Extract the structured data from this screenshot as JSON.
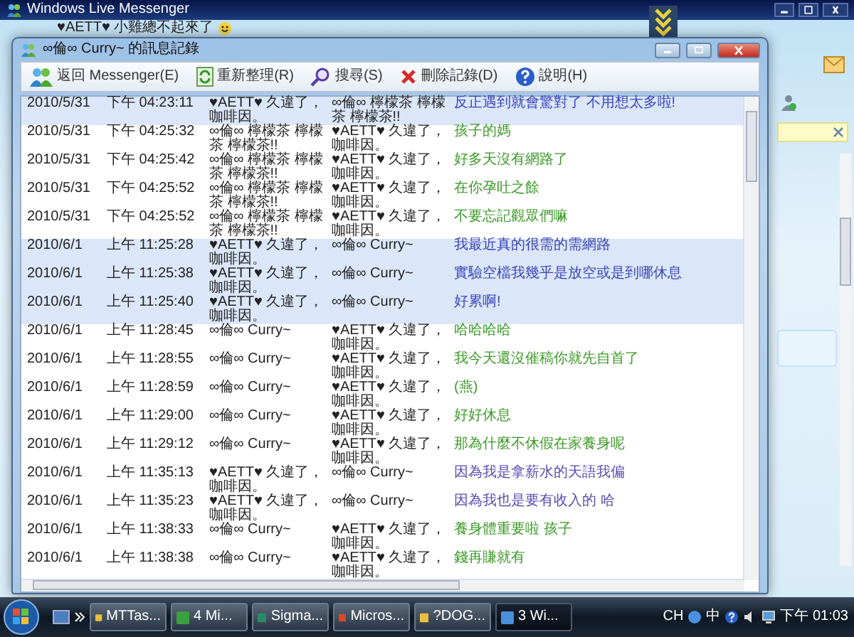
{
  "messenger": {
    "title": "Windows Live Messenger",
    "contact_status": "♥AETT♥ 小雞總不起來了"
  },
  "history_window": {
    "title": "∞倫∞ Curry~ 的訊息記錄",
    "toolbar": [
      {
        "label": "返回 Messenger(E)"
      },
      {
        "label": "重新整理(R)"
      },
      {
        "label": "搜尋(S)"
      },
      {
        "label": "刪除記錄(D)"
      },
      {
        "label": "說明(H)"
      }
    ],
    "rows": [
      {
        "date": "2010/5/31",
        "time": "下午 04:23:11",
        "from": "♥AETT♥ 久違了，咖啡因。",
        "to": "∞倫∞ 檸檬茶 檸檬茶 檸檬茶!!",
        "message": "反正遇到就會驚對了 不用想太多啦!",
        "selected": true,
        "color": "#3a44b8"
      },
      {
        "date": "2010/5/31",
        "time": "下午 04:25:32",
        "from": "∞倫∞ 檸檬茶 檸檬茶 檸檬茶!!",
        "to": "♥AETT♥ 久違了，咖啡因。",
        "message": "孩子的媽",
        "selected": false,
        "color": "#3c9a28"
      },
      {
        "date": "2010/5/31",
        "time": "下午 04:25:42",
        "from": "∞倫∞ 檸檬茶 檸檬茶 檸檬茶!!",
        "to": "♥AETT♥ 久違了，咖啡因。",
        "message": "好多天沒有網路了",
        "selected": false,
        "color": "#3c9a28"
      },
      {
        "date": "2010/5/31",
        "time": "下午 04:25:52",
        "from": "∞倫∞ 檸檬茶 檸檬茶 檸檬茶!!",
        "to": "♥AETT♥ 久違了，咖啡因。",
        "message": "在你孕吐之餘",
        "selected": false,
        "color": "#3c9a28"
      },
      {
        "date": "2010/5/31",
        "time": "下午 04:25:52",
        "from": "∞倫∞ 檸檬茶 檸檬茶 檸檬茶!!",
        "to": "♥AETT♥ 久違了，咖啡因。",
        "message": "不要忘記觀眾們嘛",
        "selected": false,
        "color": "#3c9a28"
      },
      {
        "date": "2010/6/1",
        "time": "上午 11:25:28",
        "from": "♥AETT♥ 久違了，咖啡因。",
        "to": "∞倫∞ Curry~",
        "message": "我最近真的很需的需網路",
        "selected": true,
        "color": "#3a44b8"
      },
      {
        "date": "2010/6/1",
        "time": "上午 11:25:38",
        "from": "♥AETT♥ 久違了，咖啡因。",
        "to": "∞倫∞ Curry~",
        "message": "實驗空檔我幾乎是放空或是到哪休息",
        "selected": true,
        "color": "#3a44b8"
      },
      {
        "date": "2010/6/1",
        "time": "上午 11:25:40",
        "from": "♥AETT♥ 久違了，咖啡因。",
        "to": "∞倫∞ Curry~",
        "message": "好累啊!",
        "selected": true,
        "color": "#3a44b8"
      },
      {
        "date": "2010/6/1",
        "time": "上午 11:28:45",
        "from": "∞倫∞ Curry~",
        "to": "♥AETT♥ 久違了，咖啡因。",
        "message": "哈哈哈哈",
        "selected": false,
        "color": "#3c9a28"
      },
      {
        "date": "2010/6/1",
        "time": "上午 11:28:55",
        "from": "∞倫∞ Curry~",
        "to": "♥AETT♥ 久違了，咖啡因。",
        "message": "我今天還沒催稿你就先自首了",
        "selected": false,
        "color": "#3c9a28"
      },
      {
        "date": "2010/6/1",
        "time": "上午 11:28:59",
        "from": "∞倫∞ Curry~",
        "to": "♥AETT♥ 久違了，咖啡因。",
        "message": "(燕)",
        "selected": false,
        "color": "#3c9a28"
      },
      {
        "date": "2010/6/1",
        "time": "上午 11:29:00",
        "from": "∞倫∞ Curry~",
        "to": "♥AETT♥ 久違了，咖啡因。",
        "message": "好好休息",
        "selected": false,
        "color": "#3c9a28"
      },
      {
        "date": "2010/6/1",
        "time": "上午 11:29:12",
        "from": "∞倫∞ Curry~",
        "to": "♥AETT♥ 久違了，咖啡因。",
        "message": "那為什麼不休假在家養身呢",
        "selected": false,
        "color": "#3c9a28"
      },
      {
        "date": "2010/6/1",
        "time": "上午 11:35:13",
        "from": "♥AETT♥ 久違了，咖啡因。",
        "to": "∞倫∞ Curry~",
        "message": "因為我是拿薪水的天語我偏",
        "selected": false,
        "color": "#5a4cb0"
      },
      {
        "date": "2010/6/1",
        "time": "上午 11:35:23",
        "from": "♥AETT♥ 久違了，咖啡因。",
        "to": "∞倫∞ Curry~",
        "message": "因為我也是要有收入的 哈",
        "selected": false,
        "color": "#5a4cb0"
      },
      {
        "date": "2010/6/1",
        "time": "上午 11:38:33",
        "from": "∞倫∞ Curry~",
        "to": "♥AETT♥ 久違了，咖啡因。",
        "message": "養身體重要啦 孩子",
        "selected": false,
        "color": "#3c9a28"
      },
      {
        "date": "2010/6/1",
        "time": "上午 11:38:38",
        "from": "∞倫∞ Curry~",
        "to": "♥AETT♥ 久違了，咖啡因。",
        "message": "錢再賺就有",
        "selected": false,
        "color": "#3c9a28"
      }
    ]
  },
  "taskbar": {
    "items": [
      {
        "label": "MTTas...",
        "selected": false
      },
      {
        "label": "4 Mi...",
        "selected": false
      },
      {
        "label": "Sigma...",
        "selected": false
      },
      {
        "label": "Micros...",
        "selected": false
      },
      {
        "label": "?DOG...",
        "selected": false
      },
      {
        "label": "3 Wi...",
        "selected": true
      }
    ],
    "language": "CH",
    "input_mode": "中",
    "clock": "下午 01:03"
  }
}
